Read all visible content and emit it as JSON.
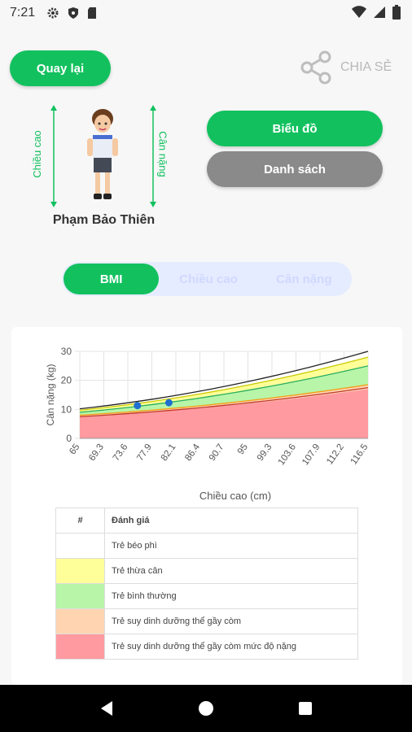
{
  "status": {
    "time": "7:21"
  },
  "header": {
    "back_label": "Quay lại",
    "share_label": "CHIA SẺ"
  },
  "actions": {
    "chart_label": "Biểu đồ",
    "list_label": "Danh sách"
  },
  "child": {
    "name": "Phạm Bảo Thiên",
    "height_label": "Chiều cao",
    "weight_label": "Cân nặng"
  },
  "tabs": [
    {
      "label": "BMI",
      "active": true
    },
    {
      "label": "Chiều cao",
      "active": false
    },
    {
      "label": "Cân nặng",
      "active": false
    }
  ],
  "chart_data": {
    "type": "area",
    "xlabel": "Chiều cao (cm)",
    "ylabel": "Cân nặng (kg)",
    "x_ticks": [
      "65",
      "69.3",
      "73.6",
      "77.9",
      "82.1",
      "86.4",
      "90.7",
      "95",
      "99.3",
      "103.6",
      "107.9",
      "112.2",
      "116.5"
    ],
    "xlim": [
      65,
      120
    ],
    "ylim": [
      0,
      30
    ],
    "y_ticks": [
      0,
      10,
      20,
      30
    ],
    "grid": true,
    "bands": [
      {
        "name": "Trẻ suy dinh dưỡng thể gầy còm mức độ nặng",
        "color": "#ff9aa0",
        "lower": [
          0,
          0
        ],
        "upper": [
          7.5,
          17
        ]
      },
      {
        "name": "Trẻ suy dinh dưỡng thể gầy còm",
        "color": "#ffd4b0",
        "lower": [
          7.5,
          17
        ],
        "upper": [
          8.0,
          18.5
        ]
      },
      {
        "name": "Trẻ bình thường",
        "color": "#b8f5a8",
        "lower": [
          8.0,
          18.5
        ],
        "upper": [
          9.0,
          25.0
        ]
      },
      {
        "name": "Trẻ thừa cân",
        "color": "#ffff99",
        "lower": [
          9.0,
          25.0
        ],
        "upper": [
          9.7,
          28.0
        ]
      },
      {
        "name": "Trẻ béo phì",
        "color": "#ffffff",
        "lower": [
          9.7,
          28.0
        ],
        "upper": [
          10.2,
          30.0
        ]
      }
    ],
    "band_x": [
      65,
      120
    ],
    "lines": [
      {
        "color": "#c0392b",
        "y": [
          7.5,
          17.5
        ]
      },
      {
        "color": "#f39c12",
        "y": [
          8.0,
          18.5
        ]
      },
      {
        "color": "#27ae60",
        "y": [
          9.0,
          25.0
        ]
      },
      {
        "color": "#c9c900",
        "y": [
          9.7,
          28.0
        ]
      },
      {
        "color": "#222222",
        "y": [
          10.2,
          30.0
        ]
      }
    ],
    "points": [
      {
        "x": 76,
        "y": 11.3
      },
      {
        "x": 82,
        "y": 12.3
      }
    ],
    "point_color": "#1e6fd0"
  },
  "legend_table": {
    "header_col1": "#",
    "header_col2": "Đánh giá",
    "rows": [
      {
        "label": "Trẻ béo phì",
        "color": "#ffffff"
      },
      {
        "label": "Trẻ thừa cân",
        "color": "#ffff99"
      },
      {
        "label": "Trẻ bình thường",
        "color": "#b8f5a8"
      },
      {
        "label": "Trẻ suy dinh dưỡng thể gầy còm",
        "color": "#ffd4b0"
      },
      {
        "label": "Trẻ suy dinh dưỡng thể gầy còm mức độ nặng",
        "color": "#ff9aa0"
      }
    ]
  },
  "colors": {
    "accent": "#12c15e",
    "secondary": "#8a8a8a"
  }
}
